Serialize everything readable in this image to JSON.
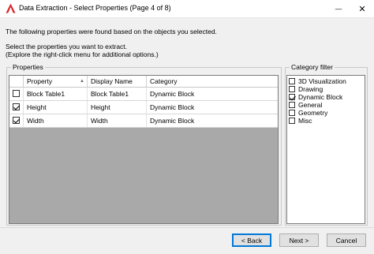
{
  "window": {
    "title": "Data Extraction - Select Properties (Page 4 of 8)",
    "minimize_glyph": "—",
    "close_glyph": "✕"
  },
  "description": {
    "line1": "The following properties were found based on the objects you selected.",
    "line2": "Select the properties you want to extract.",
    "line3": "(Explore the right-click menu for additional options.)"
  },
  "properties": {
    "group_label": "Properties",
    "columns": {
      "property": "Property",
      "display_name": "Display Name",
      "category": "Category",
      "sort_glyph": "▲"
    },
    "rows": [
      {
        "checked": false,
        "property": "Block Table1",
        "display_name": "Block Table1",
        "category": "Dynamic Block"
      },
      {
        "checked": true,
        "property": "Height",
        "display_name": "Height",
        "category": "Dynamic Block"
      },
      {
        "checked": true,
        "property": "Width",
        "display_name": "Width",
        "category": "Dynamic Block"
      }
    ]
  },
  "category_filter": {
    "group_label": "Category filter",
    "items": [
      {
        "label": "3D Visualization",
        "checked": false
      },
      {
        "label": "Drawing",
        "checked": false
      },
      {
        "label": "Dynamic Block",
        "checked": true
      },
      {
        "label": "General",
        "checked": false
      },
      {
        "label": "Geometry",
        "checked": false
      },
      {
        "label": "Misc",
        "checked": false
      }
    ]
  },
  "buttons": {
    "back": "< Back",
    "next": "Next >",
    "cancel": "Cancel"
  },
  "colors": {
    "app_icon": "#d6262b",
    "grid_background": "#a9a9a9",
    "accent": "#0078d7"
  }
}
